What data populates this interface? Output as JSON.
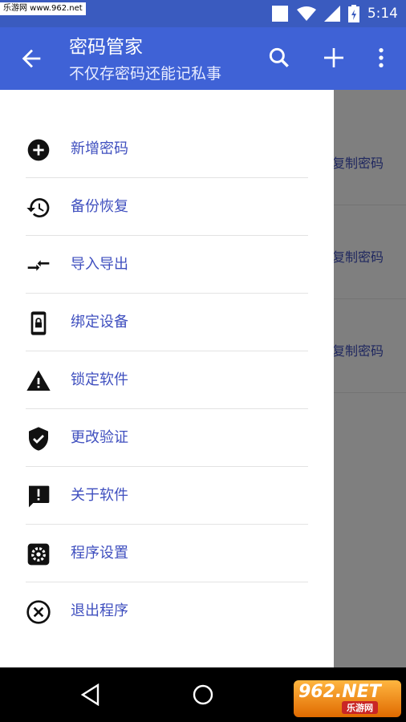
{
  "status": {
    "watermark": "乐游网 www.962.net",
    "time": "5:14"
  },
  "header": {
    "title": "密码管家",
    "subtitle": "不仅存密码还能记私事"
  },
  "icons": {
    "back": "arrow-left-icon",
    "search": "search-icon",
    "add": "plus-icon",
    "more": "more-vert-icon"
  },
  "content": {
    "rows": [
      {
        "action": "复制密码"
      },
      {
        "action": "复制密码"
      },
      {
        "action": "复制密码"
      }
    ]
  },
  "drawer": {
    "items": [
      {
        "label": "新增密码",
        "icon": "add-circle-icon"
      },
      {
        "label": "备份恢复",
        "icon": "history-icon"
      },
      {
        "label": "导入导出",
        "icon": "import-export-icon"
      },
      {
        "label": "绑定设备",
        "icon": "device-lock-icon"
      },
      {
        "label": "锁定软件",
        "icon": "warning-icon"
      },
      {
        "label": "更改验证",
        "icon": "verified-shield-icon"
      },
      {
        "label": "关于软件",
        "icon": "feedback-icon"
      },
      {
        "label": "程序设置",
        "icon": "settings-icon"
      },
      {
        "label": "退出程序",
        "icon": "cancel-circle-icon"
      }
    ]
  },
  "badge": {
    "main": "962.NET",
    "sub": "乐游网"
  }
}
